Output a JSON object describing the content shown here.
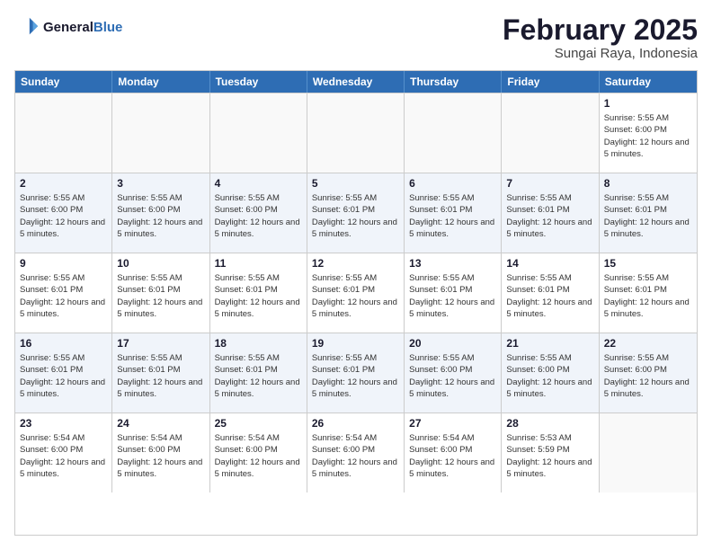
{
  "logo": {
    "line1": "General",
    "line2": "Blue"
  },
  "title": "February 2025",
  "subtitle": "Sungai Raya, Indonesia",
  "weekdays": [
    "Sunday",
    "Monday",
    "Tuesday",
    "Wednesday",
    "Thursday",
    "Friday",
    "Saturday"
  ],
  "weeks": [
    [
      {
        "day": "",
        "info": ""
      },
      {
        "day": "",
        "info": ""
      },
      {
        "day": "",
        "info": ""
      },
      {
        "day": "",
        "info": ""
      },
      {
        "day": "",
        "info": ""
      },
      {
        "day": "",
        "info": ""
      },
      {
        "day": "1",
        "info": "Sunrise: 5:55 AM\nSunset: 6:00 PM\nDaylight: 12 hours and 5 minutes."
      }
    ],
    [
      {
        "day": "2",
        "info": "Sunrise: 5:55 AM\nSunset: 6:00 PM\nDaylight: 12 hours and 5 minutes."
      },
      {
        "day": "3",
        "info": "Sunrise: 5:55 AM\nSunset: 6:00 PM\nDaylight: 12 hours and 5 minutes."
      },
      {
        "day": "4",
        "info": "Sunrise: 5:55 AM\nSunset: 6:00 PM\nDaylight: 12 hours and 5 minutes."
      },
      {
        "day": "5",
        "info": "Sunrise: 5:55 AM\nSunset: 6:01 PM\nDaylight: 12 hours and 5 minutes."
      },
      {
        "day": "6",
        "info": "Sunrise: 5:55 AM\nSunset: 6:01 PM\nDaylight: 12 hours and 5 minutes."
      },
      {
        "day": "7",
        "info": "Sunrise: 5:55 AM\nSunset: 6:01 PM\nDaylight: 12 hours and 5 minutes."
      },
      {
        "day": "8",
        "info": "Sunrise: 5:55 AM\nSunset: 6:01 PM\nDaylight: 12 hours and 5 minutes."
      }
    ],
    [
      {
        "day": "9",
        "info": "Sunrise: 5:55 AM\nSunset: 6:01 PM\nDaylight: 12 hours and 5 minutes."
      },
      {
        "day": "10",
        "info": "Sunrise: 5:55 AM\nSunset: 6:01 PM\nDaylight: 12 hours and 5 minutes."
      },
      {
        "day": "11",
        "info": "Sunrise: 5:55 AM\nSunset: 6:01 PM\nDaylight: 12 hours and 5 minutes."
      },
      {
        "day": "12",
        "info": "Sunrise: 5:55 AM\nSunset: 6:01 PM\nDaylight: 12 hours and 5 minutes."
      },
      {
        "day": "13",
        "info": "Sunrise: 5:55 AM\nSunset: 6:01 PM\nDaylight: 12 hours and 5 minutes."
      },
      {
        "day": "14",
        "info": "Sunrise: 5:55 AM\nSunset: 6:01 PM\nDaylight: 12 hours and 5 minutes."
      },
      {
        "day": "15",
        "info": "Sunrise: 5:55 AM\nSunset: 6:01 PM\nDaylight: 12 hours and 5 minutes."
      }
    ],
    [
      {
        "day": "16",
        "info": "Sunrise: 5:55 AM\nSunset: 6:01 PM\nDaylight: 12 hours and 5 minutes."
      },
      {
        "day": "17",
        "info": "Sunrise: 5:55 AM\nSunset: 6:01 PM\nDaylight: 12 hours and 5 minutes."
      },
      {
        "day": "18",
        "info": "Sunrise: 5:55 AM\nSunset: 6:01 PM\nDaylight: 12 hours and 5 minutes."
      },
      {
        "day": "19",
        "info": "Sunrise: 5:55 AM\nSunset: 6:01 PM\nDaylight: 12 hours and 5 minutes."
      },
      {
        "day": "20",
        "info": "Sunrise: 5:55 AM\nSunset: 6:00 PM\nDaylight: 12 hours and 5 minutes."
      },
      {
        "day": "21",
        "info": "Sunrise: 5:55 AM\nSunset: 6:00 PM\nDaylight: 12 hours and 5 minutes."
      },
      {
        "day": "22",
        "info": "Sunrise: 5:55 AM\nSunset: 6:00 PM\nDaylight: 12 hours and 5 minutes."
      }
    ],
    [
      {
        "day": "23",
        "info": "Sunrise: 5:54 AM\nSunset: 6:00 PM\nDaylight: 12 hours and 5 minutes."
      },
      {
        "day": "24",
        "info": "Sunrise: 5:54 AM\nSunset: 6:00 PM\nDaylight: 12 hours and 5 minutes."
      },
      {
        "day": "25",
        "info": "Sunrise: 5:54 AM\nSunset: 6:00 PM\nDaylight: 12 hours and 5 minutes."
      },
      {
        "day": "26",
        "info": "Sunrise: 5:54 AM\nSunset: 6:00 PM\nDaylight: 12 hours and 5 minutes."
      },
      {
        "day": "27",
        "info": "Sunrise: 5:54 AM\nSunset: 6:00 PM\nDaylight: 12 hours and 5 minutes."
      },
      {
        "day": "28",
        "info": "Sunrise: 5:53 AM\nSunset: 5:59 PM\nDaylight: 12 hours and 5 minutes."
      },
      {
        "day": "",
        "info": ""
      }
    ]
  ]
}
